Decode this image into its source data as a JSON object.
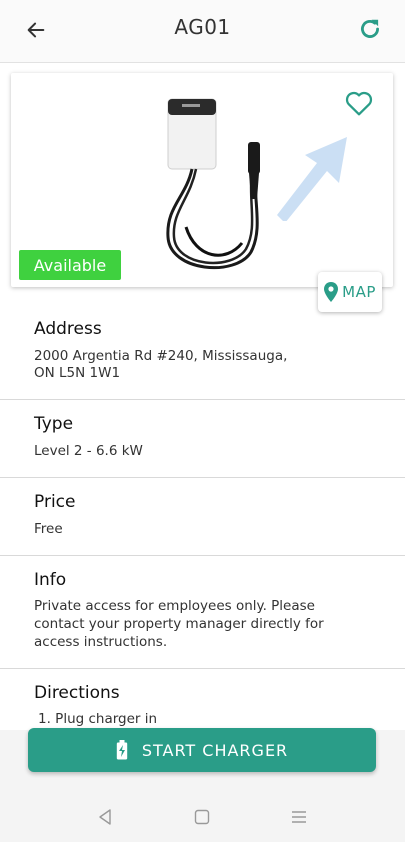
{
  "header": {
    "title": "AG01"
  },
  "card": {
    "status": "Available"
  },
  "address": {
    "title": "Address",
    "line1": "2000 Argentia Rd #240, Mississauga,",
    "line2": "ON L5N 1W1",
    "map_label": "MAP"
  },
  "type": {
    "title": "Type",
    "value": "Level 2 - 6.6 kW"
  },
  "price": {
    "title": "Price",
    "value": "Free"
  },
  "info": {
    "title": "Info",
    "line1": "Private access for employees only. Please",
    "line2": "contact your property manager directly for",
    "line3": "access instructions."
  },
  "directions": {
    "title": "Directions",
    "line1": "1. Plug charger in"
  },
  "actions": {
    "start_label": "START CHARGER"
  },
  "colors": {
    "accent": "#2a9d88",
    "available": "#3fd13f"
  }
}
